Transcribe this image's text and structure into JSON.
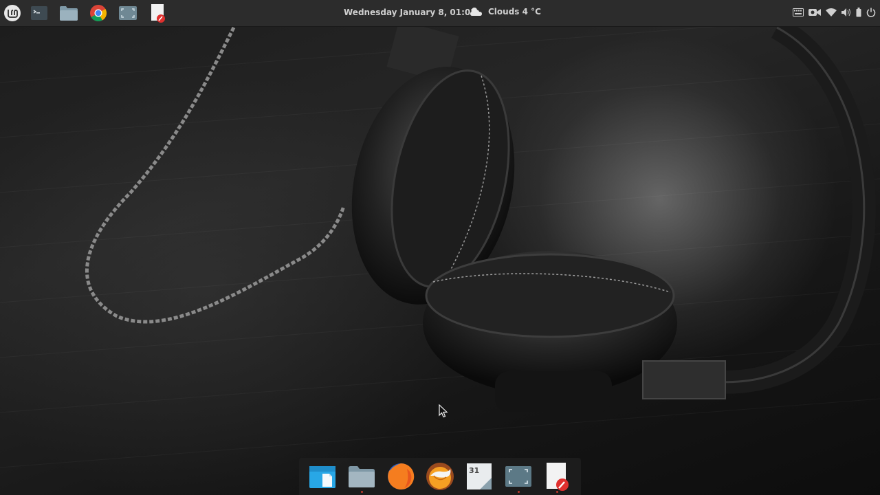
{
  "top_panel": {
    "menu_icon": "linux-mint-logo-icon",
    "launchers": [
      {
        "name": "terminal-icon"
      },
      {
        "name": "files-icon"
      },
      {
        "name": "chrome-icon"
      },
      {
        "name": "screenshot-icon"
      },
      {
        "name": "text-editor-icon"
      }
    ],
    "clock": "Wednesday January  8, 01:05",
    "weather": "Clouds 4 °C",
    "tray_icons": [
      "keyboard-icon",
      "camera-icon",
      "wifi-icon",
      "volume-icon",
      "battery-icon",
      "power-icon"
    ]
  },
  "dock": {
    "items": [
      {
        "name": "dock-item-software-manager",
        "icon": "store-icon",
        "running": false
      },
      {
        "name": "dock-item-files",
        "icon": "folder-icon",
        "running": true
      },
      {
        "name": "dock-item-firefox",
        "icon": "firefox-icon",
        "running": false
      },
      {
        "name": "dock-item-thunderbird",
        "icon": "thunderbird-icon",
        "running": false
      },
      {
        "name": "dock-item-calendar",
        "icon": "calendar-icon",
        "label": "31",
        "running": false
      },
      {
        "name": "dock-item-screenshot",
        "icon": "screenshot-icon",
        "running": true
      },
      {
        "name": "dock-item-text-editor",
        "icon": "text-editor-icon",
        "running": true
      }
    ]
  },
  "colors": {
    "panel_bg": "#2c2c2c",
    "panel_text": "#cfcfcf",
    "running_indicator": "#c0392b",
    "accent_blue": "#3aa0e0"
  }
}
